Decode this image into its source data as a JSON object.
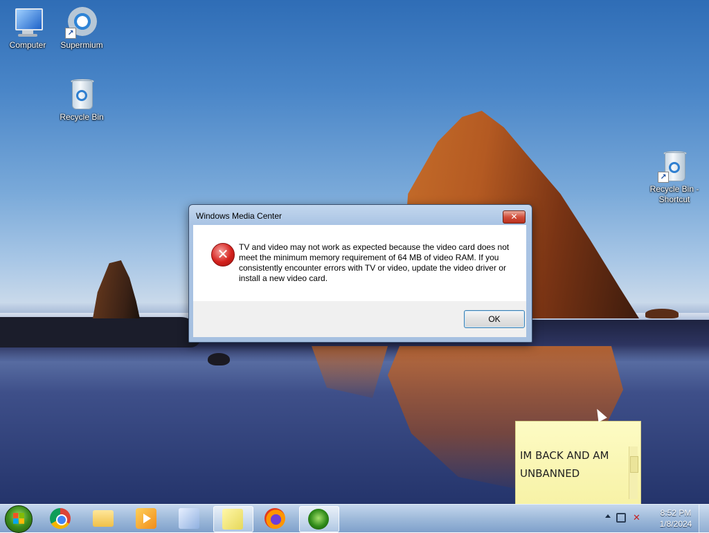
{
  "desktop": {
    "icons": [
      {
        "label": "Computer"
      },
      {
        "label": "Supermium"
      },
      {
        "label": "Recycle Bin"
      },
      {
        "label": "Recycle Bin - Shortcut"
      }
    ]
  },
  "dialog": {
    "title": "Windows Media Center",
    "close_label": "✕",
    "message": "TV and video may not work as expected because the video card does not meet the minimum memory requirement of 64 MB of video RAM. If you consistently encounter errors with TV or video, update the video driver or install a new video card.",
    "ok_label": "OK"
  },
  "sticky_note": {
    "text": "IM BACK AND AM UNBANNED"
  },
  "taskbar": {
    "apps": [
      {
        "name": "Google Chrome",
        "icon": "chrome-icon"
      },
      {
        "name": "Windows Explorer",
        "icon": "folder-icon"
      },
      {
        "name": "Windows Media Player",
        "icon": "media-player-icon"
      },
      {
        "name": "Search",
        "icon": "search-icon"
      },
      {
        "name": "Sticky Notes",
        "icon": "sticky-notes-icon"
      },
      {
        "name": "Firefox",
        "icon": "firefox-icon"
      },
      {
        "name": "Windows Media Center",
        "icon": "media-center-icon"
      }
    ],
    "clock": {
      "time": "8:52 PM",
      "date": "1/8/2024"
    }
  }
}
